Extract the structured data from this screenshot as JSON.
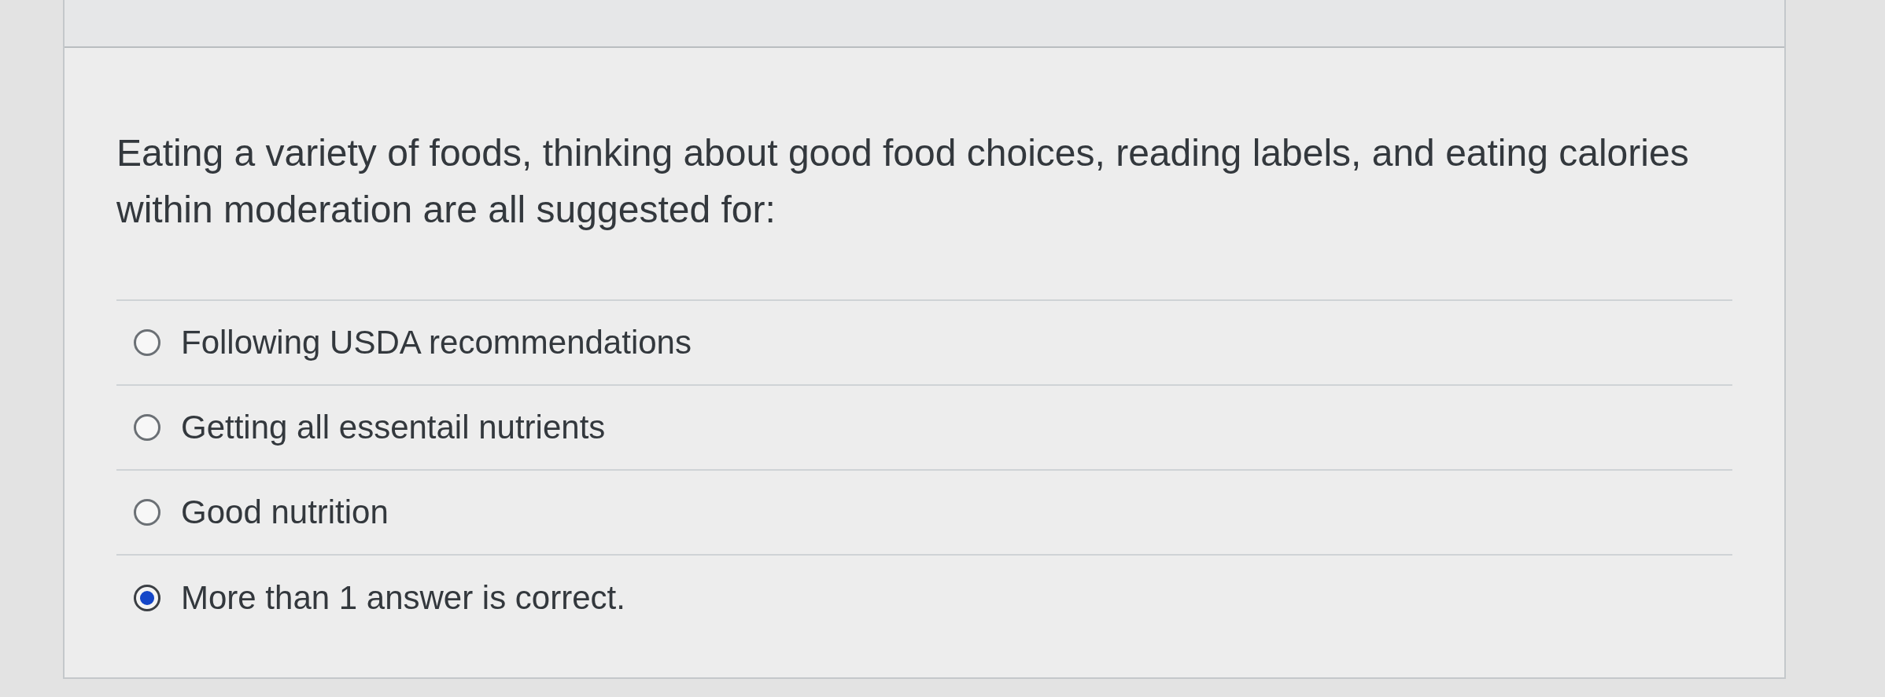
{
  "question": {
    "text": "Eating a variety of foods, thinking about good food choices, reading labels, and eating calories within moderation are all suggested for:"
  },
  "answers": [
    {
      "label": "Following USDA recommendations",
      "selected": false
    },
    {
      "label": "Getting all essentail nutrients",
      "selected": false
    },
    {
      "label": "Good nutrition",
      "selected": false
    },
    {
      "label": "More than 1 answer is correct.",
      "selected": true
    }
  ]
}
